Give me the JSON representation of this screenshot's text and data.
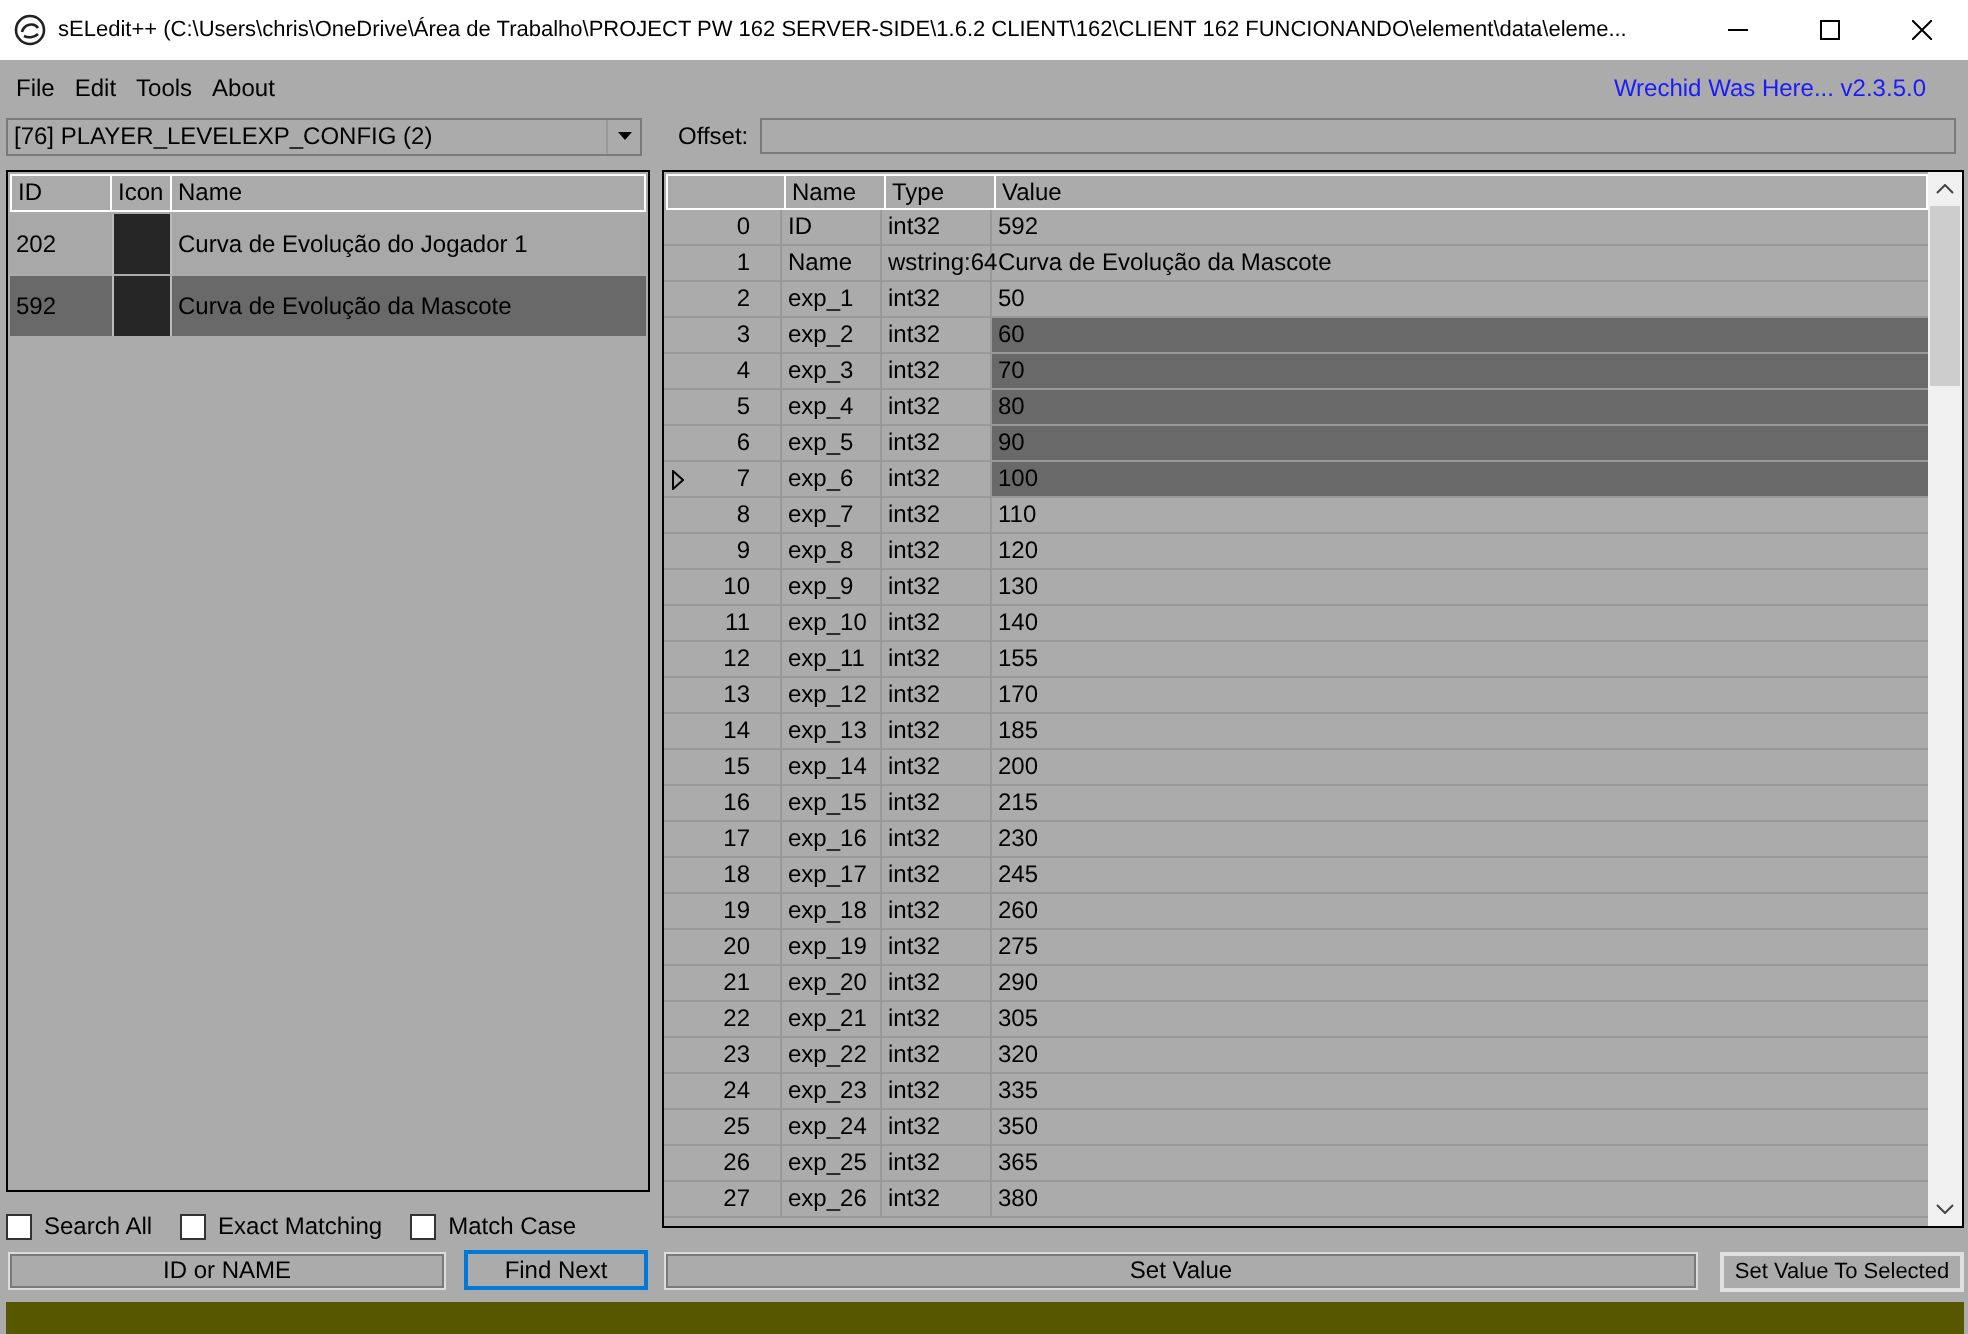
{
  "window": {
    "title": "sELedit++ (C:\\Users\\chris\\OneDrive\\Área de Trabalho\\PROJECT PW 162 SERVER-SIDE\\1.6.2 CLIENT\\162\\CLIENT 162 FUNCIONANDO\\element\\data\\eleme..."
  },
  "menu": [
    "File",
    "Edit",
    "Tools",
    "About"
  ],
  "version_label": "Wrechid Was Here... v2.3.5.0",
  "list_selector": {
    "value": "[76] PLAYER_LEVELEXP_CONFIG (2)"
  },
  "offset": {
    "label": "Offset:"
  },
  "item_list": {
    "columns": [
      "ID",
      "Icon",
      "Name"
    ],
    "rows": [
      {
        "id": "202",
        "name": "Curva de Evolução do Jogador 1",
        "selected": false
      },
      {
        "id": "592",
        "name": "Curva de Evolução da Mascote",
        "selected": true
      }
    ]
  },
  "field_grid": {
    "columns": [
      "Name",
      "Type",
      "Value"
    ],
    "rows": [
      {
        "index": "0",
        "name": "ID",
        "type": "int32",
        "value": "592",
        "selected": false,
        "current": false
      },
      {
        "index": "1",
        "name": "Name",
        "type": "wstring:64",
        "value": "Curva de Evolução da Mascote",
        "selected": false,
        "current": false
      },
      {
        "index": "2",
        "name": "exp_1",
        "type": "int32",
        "value": "50",
        "selected": false,
        "current": false
      },
      {
        "index": "3",
        "name": "exp_2",
        "type": "int32",
        "value": "60",
        "selected": true,
        "current": false
      },
      {
        "index": "4",
        "name": "exp_3",
        "type": "int32",
        "value": "70",
        "selected": true,
        "current": false
      },
      {
        "index": "5",
        "name": "exp_4",
        "type": "int32",
        "value": "80",
        "selected": true,
        "current": false
      },
      {
        "index": "6",
        "name": "exp_5",
        "type": "int32",
        "value": "90",
        "selected": true,
        "current": false
      },
      {
        "index": "7",
        "name": "exp_6",
        "type": "int32",
        "value": "100",
        "selected": true,
        "current": true
      },
      {
        "index": "8",
        "name": "exp_7",
        "type": "int32",
        "value": "110",
        "selected": false,
        "current": false
      },
      {
        "index": "9",
        "name": "exp_8",
        "type": "int32",
        "value": "120",
        "selected": false,
        "current": false
      },
      {
        "index": "10",
        "name": "exp_9",
        "type": "int32",
        "value": "130",
        "selected": false,
        "current": false
      },
      {
        "index": "11",
        "name": "exp_10",
        "type": "int32",
        "value": "140",
        "selected": false,
        "current": false
      },
      {
        "index": "12",
        "name": "exp_11",
        "type": "int32",
        "value": "155",
        "selected": false,
        "current": false
      },
      {
        "index": "13",
        "name": "exp_12",
        "type": "int32",
        "value": "170",
        "selected": false,
        "current": false
      },
      {
        "index": "14",
        "name": "exp_13",
        "type": "int32",
        "value": "185",
        "selected": false,
        "current": false
      },
      {
        "index": "15",
        "name": "exp_14",
        "type": "int32",
        "value": "200",
        "selected": false,
        "current": false
      },
      {
        "index": "16",
        "name": "exp_15",
        "type": "int32",
        "value": "215",
        "selected": false,
        "current": false
      },
      {
        "index": "17",
        "name": "exp_16",
        "type": "int32",
        "value": "230",
        "selected": false,
        "current": false
      },
      {
        "index": "18",
        "name": "exp_17",
        "type": "int32",
        "value": "245",
        "selected": false,
        "current": false
      },
      {
        "index": "19",
        "name": "exp_18",
        "type": "int32",
        "value": "260",
        "selected": false,
        "current": false
      },
      {
        "index": "20",
        "name": "exp_19",
        "type": "int32",
        "value": "275",
        "selected": false,
        "current": false
      },
      {
        "index": "21",
        "name": "exp_20",
        "type": "int32",
        "value": "290",
        "selected": false,
        "current": false
      },
      {
        "index": "22",
        "name": "exp_21",
        "type": "int32",
        "value": "305",
        "selected": false,
        "current": false
      },
      {
        "index": "23",
        "name": "exp_22",
        "type": "int32",
        "value": "320",
        "selected": false,
        "current": false
      },
      {
        "index": "24",
        "name": "exp_23",
        "type": "int32",
        "value": "335",
        "selected": false,
        "current": false
      },
      {
        "index": "25",
        "name": "exp_24",
        "type": "int32",
        "value": "350",
        "selected": false,
        "current": false
      },
      {
        "index": "26",
        "name": "exp_25",
        "type": "int32",
        "value": "365",
        "selected": false,
        "current": false
      },
      {
        "index": "27",
        "name": "exp_26",
        "type": "int32",
        "value": "380",
        "selected": false,
        "current": false
      }
    ]
  },
  "search_options": [
    {
      "label": "Search All",
      "checked": false
    },
    {
      "label": "Exact Matching",
      "checked": false
    },
    {
      "label": "Match Case",
      "checked": false
    }
  ],
  "search_field": {
    "value": "ID or NAME"
  },
  "find_button": {
    "label": "Find Next",
    "focused": true
  },
  "value_field": {
    "value": "Set Value"
  },
  "set_button": {
    "label": "Set Value To Selected",
    "focused": false
  },
  "progress": {
    "level": 1
  }
}
